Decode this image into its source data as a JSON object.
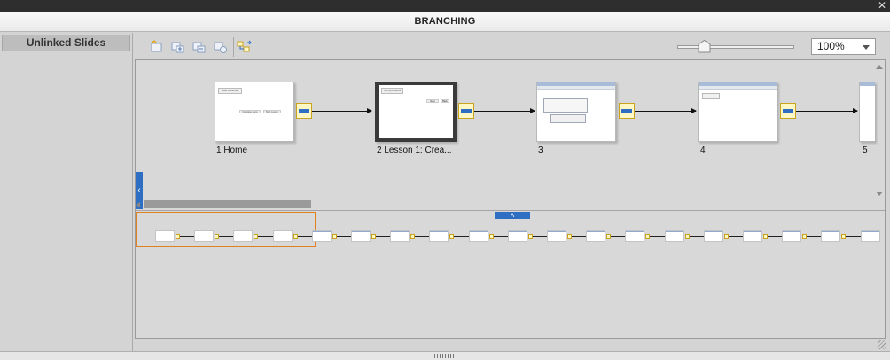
{
  "window": {
    "title": "BRANCHING"
  },
  "left_panel": {
    "title": "Unlinked Slides"
  },
  "toolbar": {
    "icons": [
      "create-group-icon",
      "expand-group-icon",
      "collapse-group-icon",
      "ungroup-icon",
      "export-flowchart-icon"
    ],
    "zoom": "100%"
  },
  "slides": [
    {
      "label": "1  Home",
      "lines": [
        "Add to Home",
        "Complete steps",
        "Start Lesson"
      ]
    },
    {
      "label": "2  Lesson 1: Crea...",
      "lines": [
        "Set up options",
        "Next",
        "Back"
      ]
    },
    {
      "label": "3"
    },
    {
      "label": "4"
    },
    {
      "label": "5"
    }
  ],
  "colors": {
    "accent": "#2f6fc3",
    "connector_fill": "#fff7c4",
    "viewport": "#e08020"
  }
}
